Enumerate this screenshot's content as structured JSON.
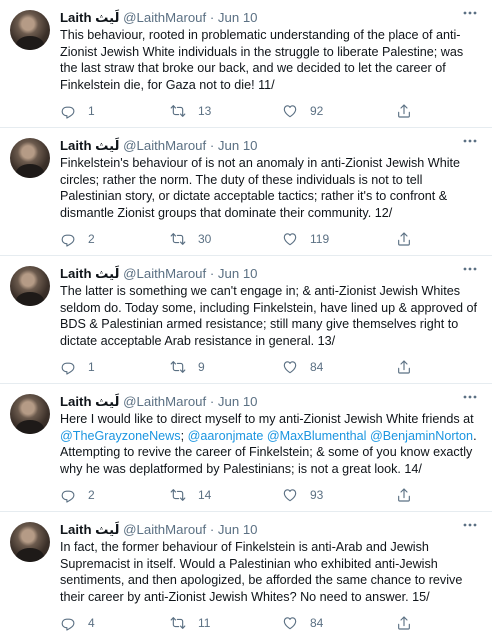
{
  "tweets": [
    {
      "name": "Laith لَيث",
      "handle": "@LaithMarouf",
      "sep": " · ",
      "date": "Jun 10",
      "text": "This behaviour, rooted in problematic understanding of the place of anti-Zionist Jewish White individuals in the struggle to liberate Palestine; was the last straw that broke our back, and we decided to let the career of Finkelstein die, for Gaza not to die! 11/",
      "replies": "1",
      "retweets": "13",
      "likes": "92"
    },
    {
      "name": "Laith لَيث",
      "handle": "@LaithMarouf",
      "sep": " · ",
      "date": "Jun 10",
      "text": "Finkelstein's behaviour of is not an anomaly in anti-Zionist Jewish White circles; rather the norm. The duty of these individuals is not to tell Palestinian story, or dictate acceptable tactics; rather it's to confront & dismantle Zionist groups that dominate their community. 12/",
      "replies": "2",
      "retweets": "30",
      "likes": "119"
    },
    {
      "name": "Laith لَيث",
      "handle": "@LaithMarouf",
      "sep": " · ",
      "date": "Jun 10",
      "text": "The latter is something we can't engage in; & anti-Zionist Jewish Whites seldom do. Today some, including Finkelstein, have lined up & approved of BDS & Palestinian armed resistance; still many give themselves right to dictate acceptable Arab resistance in general. 13/",
      "replies": "1",
      "retweets": "9",
      "likes": "84"
    },
    {
      "name": "Laith لَيث",
      "handle": "@LaithMarouf",
      "sep": " · ",
      "date": "Jun 10",
      "text_before": "Here I would like to direct myself to my anti-Zionist Jewish White friends at ",
      "mention1": "@TheGrayzoneNews",
      "text_sep1": "; ",
      "mention2": "@aaronjmate",
      "text_sep2": " ",
      "mention3": "@MaxBlumenthal",
      "text_sep3": " ",
      "mention4": "@BenjaminNorton",
      "text_after": ". Attempting to revive the career of Finkelstein; & some of you know exactly why he was deplatformed by Palestinians; is not a great look. 14/",
      "replies": "2",
      "retweets": "14",
      "likes": "93"
    },
    {
      "name": "Laith لَيث",
      "handle": "@LaithMarouf",
      "sep": " · ",
      "date": "Jun 10",
      "text": "In fact, the former behaviour of Finkelstein is anti-Arab and Jewish Supremacist in itself. Would a Palestinian who exhibited anti-Jewish sentiments, and then apologized, be afforded the same chance to revive their career by anti-Zionist Jewish Whites? No need to answer. 15/",
      "replies": "4",
      "retweets": "11",
      "likes": "84"
    }
  ],
  "icons": {
    "reply": "reply-icon",
    "retweet": "retweet-icon",
    "like": "heart-icon",
    "share": "share-icon",
    "more": "more-icon"
  },
  "colors": {
    "text": "#0f1419",
    "secondary": "#5b7083",
    "link": "#1b95e0",
    "divider": "#e6ecf0"
  }
}
